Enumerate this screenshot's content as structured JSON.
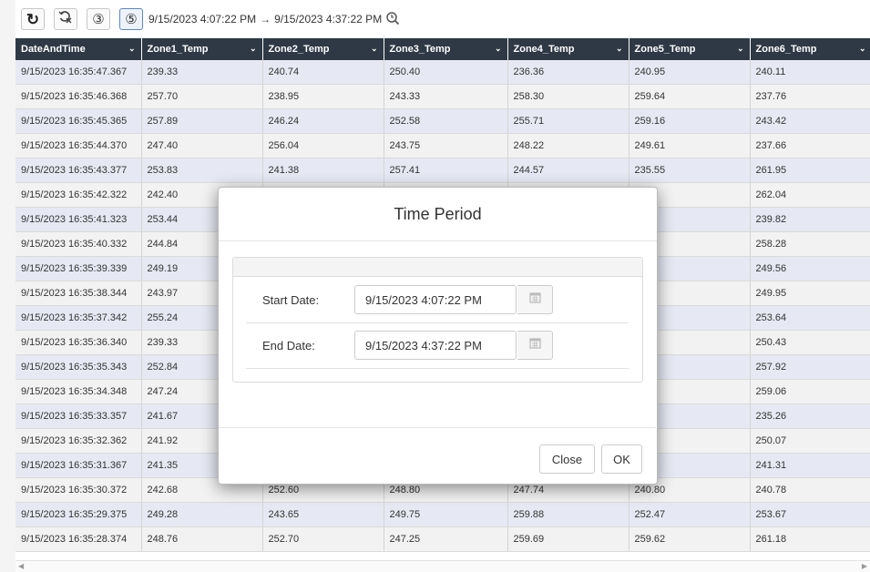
{
  "toolbar": {
    "buttons": [
      {
        "name": "refresh-icon",
        "glyph": "↻"
      },
      {
        "name": "clear-filter-icon",
        "glyph": ""
      },
      {
        "name": "history-icon",
        "glyph": "③"
      },
      {
        "name": "time-period-icon",
        "glyph": "⑤"
      }
    ],
    "range_start": "9/15/2023 4:07:22 PM",
    "range_arrow": "→",
    "range_end": "9/15/2023 4:37:22 PM"
  },
  "grid": {
    "columns": [
      "DateAndTime",
      "Zone1_Temp",
      "Zone2_Temp",
      "Zone3_Temp",
      "Zone4_Temp",
      "Zone5_Temp",
      "Zone6_Temp"
    ],
    "rows": [
      [
        "9/15/2023 16:35:47.367",
        "239.33",
        "240.74",
        "250.40",
        "236.36",
        "240.95",
        "240.11"
      ],
      [
        "9/15/2023 16:35:46.368",
        "257.70",
        "238.95",
        "243.33",
        "258.30",
        "259.64",
        "237.76"
      ],
      [
        "9/15/2023 16:35:45.365",
        "257.89",
        "246.24",
        "252.58",
        "255.71",
        "259.16",
        "243.42"
      ],
      [
        "9/15/2023 16:35:44.370",
        "247.40",
        "256.04",
        "243.75",
        "248.22",
        "249.61",
        "237.66"
      ],
      [
        "9/15/2023 16:35:43.377",
        "253.83",
        "241.38",
        "257.41",
        "244.57",
        "235.55",
        "261.95"
      ],
      [
        "9/15/2023 16:35:42.322",
        "242.40",
        "",
        "",
        "",
        ".88",
        "262.04"
      ],
      [
        "9/15/2023 16:35:41.323",
        "253.44",
        "",
        "",
        "",
        ".04",
        "239.82"
      ],
      [
        "9/15/2023 16:35:40.332",
        "244.84",
        "",
        "",
        "",
        ".94",
        "258.28"
      ],
      [
        "9/15/2023 16:35:39.339",
        "249.19",
        "",
        "",
        "",
        ".82",
        "249.56"
      ],
      [
        "9/15/2023 16:35:38.344",
        "243.97",
        "",
        "",
        "",
        ".72",
        "249.95"
      ],
      [
        "9/15/2023 16:35:37.342",
        "255.24",
        "",
        "",
        "",
        ".90",
        "253.64"
      ],
      [
        "9/15/2023 16:35:36.340",
        "239.33",
        "",
        "",
        "",
        ".49",
        "250.43"
      ],
      [
        "9/15/2023 16:35:35.343",
        "252.84",
        "",
        "",
        "",
        ".44",
        "257.92"
      ],
      [
        "9/15/2023 16:35:34.348",
        "247.24",
        "",
        "",
        "",
        ".48",
        "259.06"
      ],
      [
        "9/15/2023 16:35:33.357",
        "241.67",
        "",
        "",
        "",
        ".67",
        "235.26"
      ],
      [
        "9/15/2023 16:35:32.362",
        "241.92",
        "",
        "",
        "",
        ".16",
        "250.07"
      ],
      [
        "9/15/2023 16:35:31.367",
        "241.35",
        "",
        "",
        "",
        ".67",
        "241.31"
      ],
      [
        "9/15/2023 16:35:30.372",
        "242.68",
        "252.60",
        "248.80",
        "247.74",
        "240.80",
        "240.78"
      ],
      [
        "9/15/2023 16:35:29.375",
        "249.28",
        "243.65",
        "249.75",
        "259.88",
        "252.47",
        "253.67"
      ],
      [
        "9/15/2023 16:35:28.374",
        "248.76",
        "252.70",
        "247.25",
        "259.69",
        "259.62",
        "261.18"
      ]
    ]
  },
  "dialog": {
    "title": "Time Period",
    "start_label": "Start Date:",
    "start_value": "9/15/2023 4:07:22 PM",
    "end_label": "End Date:",
    "end_value": "9/15/2023 4:37:22 PM",
    "close_label": "Close",
    "ok_label": "OK"
  },
  "colors": {
    "header_bg": "#2e3945",
    "row_alt": "#e6e9f3",
    "row": "#f2f2f2",
    "accent": "#5a87c9"
  }
}
